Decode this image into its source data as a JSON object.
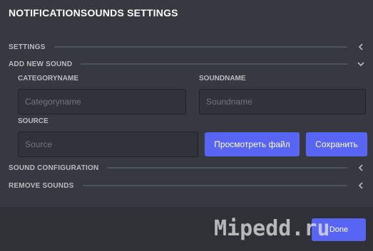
{
  "modal": {
    "title": "NOTIFICATIONSOUNDS SETTINGS"
  },
  "sections": {
    "settings": {
      "label": "SETTINGS",
      "expanded": false,
      "icon": "chevron-left-icon"
    },
    "add_new_sound": {
      "label": "ADD NEW SOUND",
      "expanded": true,
      "icon": "chevron-down-icon"
    },
    "sound_configuration": {
      "label": "SOUND CONFIGURATION",
      "expanded": false,
      "icon": "chevron-left-icon"
    },
    "remove_sounds": {
      "label": "REMOVE SOUNDS",
      "expanded": false,
      "icon": "chevron-left-icon"
    }
  },
  "form": {
    "category_label": "CATEGORYNAME",
    "category_placeholder": "Categoryname",
    "sound_label": "SOUNDNAME",
    "sound_placeholder": "Soundname",
    "source_label": "SOURCE",
    "source_placeholder": "Source",
    "browse_button": "Просмотреть файл",
    "save_button": "Сохранить"
  },
  "footer": {
    "done_button": "Done"
  },
  "watermark": {
    "text": "Mipedd.ru"
  },
  "colors": {
    "background": "#36393f",
    "footer": "#2f3136",
    "accent": "#5865f2"
  }
}
